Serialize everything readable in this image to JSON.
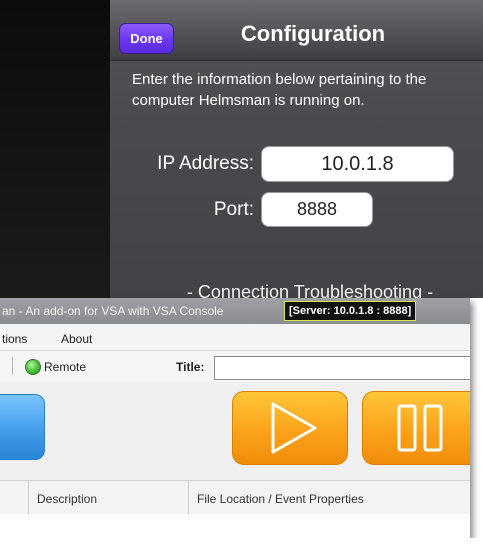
{
  "ipad": {
    "done_label": "Done",
    "title": "Configuration",
    "intro": "Enter the information below pertaining to the computer Helmsman is running on.",
    "ip_label": "IP Address:",
    "ip_value": "10.0.1.8",
    "port_label": "Port:",
    "port_value": "8888",
    "troubleshooting": "- Connection Troubleshooting -"
  },
  "window": {
    "title": "an - An add-on for VSA with VSA Console",
    "server_badge": "[Server: 10.0.1.8 : 8888]",
    "menu": [
      "tions",
      "About"
    ],
    "toolbar": {
      "remote_label": "Remote",
      "title_label": "Title:",
      "title_value": ""
    },
    "columns": [
      "Description",
      "File Location / Event Properties"
    ]
  },
  "colors": {
    "done_button": "#6a35f0",
    "server_badge_border": "#d9e34f",
    "remote_status": "#4bc23c",
    "play_pause_button": "#fba219",
    "blue_button": "#3f9ae8"
  }
}
